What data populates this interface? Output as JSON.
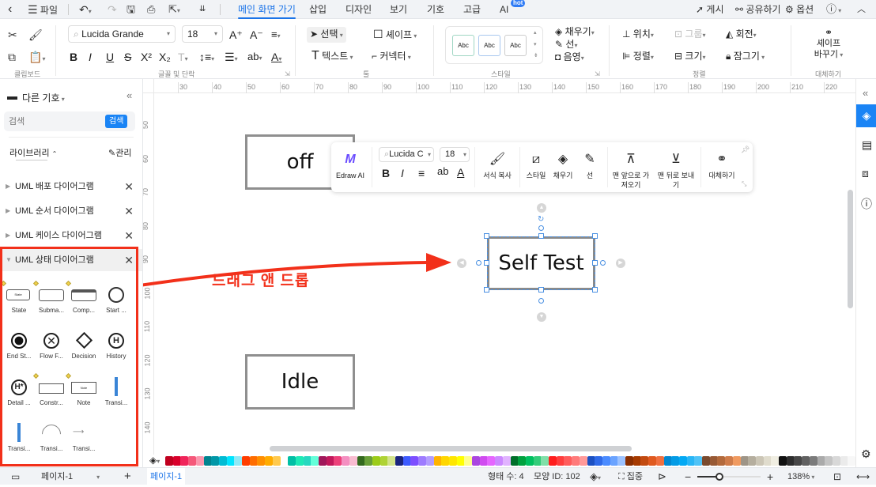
{
  "topbar": {
    "back": "‹",
    "file_menu": "파일",
    "tabs": [
      {
        "label": "메인 화면 가기",
        "active": true
      },
      {
        "label": "삽입"
      },
      {
        "label": "디자인"
      },
      {
        "label": "보기"
      },
      {
        "label": "기호"
      },
      {
        "label": "고급"
      },
      {
        "label": "AI",
        "badge": "hot"
      }
    ],
    "right": {
      "publish": "게시",
      "share": "공유하기",
      "options": "옵션"
    }
  },
  "ribbon": {
    "clipboard_label": "클립보드",
    "font": {
      "family": "Lucida Grande",
      "size": "18",
      "group_label": "글꼴 및 단락"
    },
    "tools": {
      "select": "선택",
      "shape": "셰이프",
      "text": "텍스트",
      "connector": "커넥터",
      "group_label": "툴"
    },
    "style": {
      "samples": [
        "Abc",
        "Abc",
        "Abc"
      ],
      "fill": "채우기",
      "line": "선",
      "shadow": "음영",
      "group_label": "스타일"
    },
    "arrange": {
      "position": "위치",
      "group": "그룹",
      "rotate": "회전",
      "align": "정렬",
      "size": "크기",
      "lock": "잠그기",
      "group_label": "정렬"
    },
    "replace": {
      "label_line1": "셰이프",
      "label_line2": "바꾸기",
      "group_label": "대체하기"
    }
  },
  "sidebar": {
    "title": "다른 기호",
    "search_placeholder": "검색",
    "search_button": "검색",
    "library_label": "라이브러리",
    "manage_label": "관리",
    "libraries": [
      {
        "name": "UML 배포 다이어그램",
        "expanded": false
      },
      {
        "name": "UML 순서 다이어그램",
        "expanded": false
      },
      {
        "name": "UML 케이스 다이어그램",
        "expanded": false
      },
      {
        "name": "UML 상태 다이어그램",
        "expanded": true
      }
    ],
    "shapes": [
      "State",
      "Subma...",
      "Comp...",
      "Start ...",
      "End St...",
      "Flow F...",
      "Decision",
      "History",
      "Detail ...",
      "Constr...",
      "Note",
      "Transi...",
      "Transi...",
      "Transi...",
      "Transi..."
    ]
  },
  "canvas": {
    "ruler_h": [
      "30",
      "40",
      "50",
      "60",
      "70",
      "80",
      "90",
      "100",
      "110",
      "120",
      "130",
      "140",
      "150",
      "160",
      "170",
      "180",
      "190",
      "200",
      "210",
      "220"
    ],
    "ruler_v": [
      "50",
      "60",
      "70",
      "80",
      "90",
      "100",
      "110",
      "120",
      "130",
      "140"
    ],
    "shapes": {
      "off": "off",
      "self_test": "Self Test",
      "idle": "Idle"
    },
    "annotation": "드래그 앤 드롭",
    "annotation_color": "#e8321e"
  },
  "floating_toolbar": {
    "ai": "Edraw AI",
    "font": "Lucida C",
    "size": "18",
    "format_painter": "서식 복사",
    "style": "스타일",
    "fill": "채우기",
    "line": "선",
    "bring_front": "맨 앞으로 가져오기",
    "send_back": "맨 뒤로 보내기",
    "replace": "대체하기"
  },
  "palette": [
    "#c0001f",
    "#d9002b",
    "#f0245a",
    "#f5587a",
    "#fb97ae",
    "#00838f",
    "#0097a7",
    "#00bcd4",
    "#00e5ff",
    "#8fe9f6",
    "#ff3d00",
    "#ff6d00",
    "#ff8f00",
    "#ffab00",
    "#ffc94d",
    "#ffffff",
    "#00bfa5",
    "#1de9b6",
    "#26d8c0",
    "#64ffda",
    "#a0175a",
    "#c2185b",
    "#ec407a",
    "#f48fc1",
    "#f8bbd0",
    "#33691e",
    "#689f38",
    "#9ccc1a",
    "#afd335",
    "#d2e38a",
    "#1a237e",
    "#3d5afe",
    "#7c4dff",
    "#9e7bff",
    "#b39dfe",
    "#ffb300",
    "#ffd600",
    "#ffe600",
    "#ffff00",
    "#ffff8d",
    "#aa46e0",
    "#d04bf0",
    "#e566ff",
    "#cc88ff",
    "#e1b3ff",
    "#00702a",
    "#00a23f",
    "#00c060",
    "#33cc7a",
    "#80dfa8",
    "#ff1d1d",
    "#ff3d3d",
    "#ff5c5c",
    "#ff7a7a",
    "#ff9999",
    "#1b50c2",
    "#2f6ae8",
    "#4a8bff",
    "#6aa3ff",
    "#9cc2ff",
    "#8a2e00",
    "#a63a00",
    "#c24a10",
    "#e05a20",
    "#f07040",
    "#0288d1",
    "#039be5",
    "#03a9f4",
    "#29b6f6",
    "#4fc3f7",
    "#7a4a2e",
    "#985a35",
    "#b36a3c",
    "#cf7c4a",
    "#f09a60",
    "#9e9587",
    "#b5ae9e",
    "#ccc6b6",
    "#e0dccd",
    "#f0eee2",
    "#111111",
    "#2d2d2d",
    "#474747",
    "#616161",
    "#7b7b7b",
    "#aaaaaa",
    "#c4c4c4",
    "#d8d8d8",
    "#ebebeb",
    "#f7f7f7"
  ],
  "status": {
    "page_selector": "페이지-1",
    "add_page": "+",
    "active_page": "페이지-1",
    "shape_count": "형태 수: 4",
    "shape_id": "모양 ID: 102",
    "focus": "집중",
    "zoom_level": "138%",
    "zoom_fraction": 0.35
  }
}
